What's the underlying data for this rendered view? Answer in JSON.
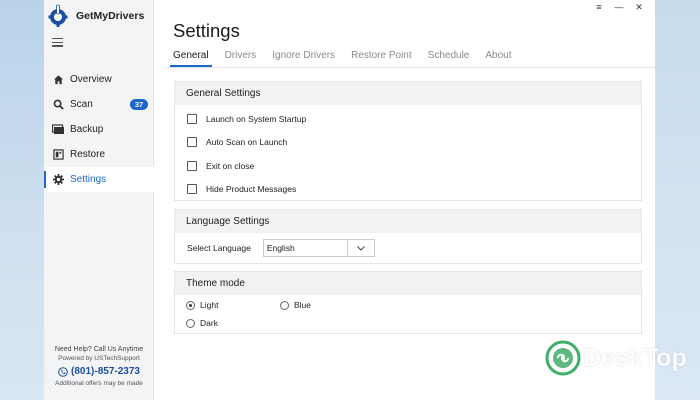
{
  "app": {
    "name": "GetMyDrivers"
  },
  "window": {
    "controls": [
      "≡",
      "—",
      "✕"
    ]
  },
  "sidebar": {
    "items": [
      {
        "label": "Overview",
        "icon": "home-icon"
      },
      {
        "label": "Scan",
        "icon": "search-icon",
        "badge": "37"
      },
      {
        "label": "Backup",
        "icon": "backup-icon"
      },
      {
        "label": "Restore",
        "icon": "restore-icon"
      },
      {
        "label": "Settings",
        "icon": "gear-icon",
        "active": true
      }
    ],
    "footer": {
      "help": "Need Help? Call Us Anytime",
      "powered": "Powered by USTechSupport",
      "phone": "(801)-857-2373",
      "offers": "Additional offers may be made"
    }
  },
  "main": {
    "title": "Settings",
    "tabs": [
      "General",
      "Drivers",
      "Ignore Drivers",
      "Restore Point",
      "Schedule",
      "About"
    ],
    "active_tab": "General",
    "general_settings": {
      "title": "General Settings",
      "options": [
        {
          "label": "Launch on System Startup",
          "checked": false
        },
        {
          "label": "Auto Scan on Launch",
          "checked": false
        },
        {
          "label": "Exit on close",
          "checked": false
        },
        {
          "label": "Hide Product Messages",
          "checked": false
        }
      ]
    },
    "language_settings": {
      "title": "Language Settings",
      "label": "Select Language",
      "value": "English"
    },
    "theme_mode": {
      "title": "Theme mode",
      "options": [
        {
          "label": "Light",
          "selected": true
        },
        {
          "label": "Blue",
          "selected": false
        },
        {
          "label": "Dark",
          "selected": false
        }
      ]
    }
  },
  "watermark": {
    "text": "DeskTop"
  },
  "colors": {
    "accent": "#1c67c9",
    "brand_dark": "#1b4e9e",
    "sidebar_bg": "#f3f4f6",
    "watermark_green": "#3fae6a"
  }
}
